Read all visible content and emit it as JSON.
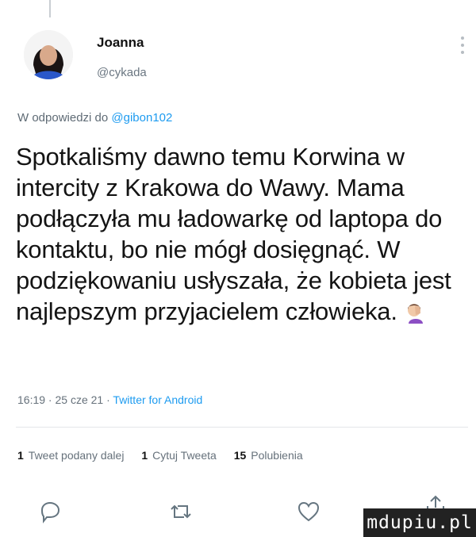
{
  "author": {
    "name": "Joanna",
    "handle": "@cykada"
  },
  "reply": {
    "prefix": "W odpowiedzi do",
    "mention": "@gibon102"
  },
  "tweet": {
    "text": "Spotkaliśmy dawno temu Korwina w intercity z Krakowa do Wawy. Mama podłączyła mu ładowarkę od laptopa do kontaktu, bo nie mógł dosięgnąć. W podziękowaniu usłyszała, że kobieta jest najlepszym przyjacielem człowieka.",
    "emoji_icon": "facepalm-icon"
  },
  "meta": {
    "time": "16:19",
    "sep1": " · ",
    "date": "25 cze 21",
    "sep2": " · ",
    "app": "Twitter for Android"
  },
  "stats": {
    "retweets_count": "1",
    "retweets_label": "Tweet podany dalej",
    "quotes_count": "1",
    "quotes_label": "Cytuj Tweeta",
    "likes_count": "15",
    "likes_label": "Polubienia"
  },
  "actions": {
    "icons": [
      "reply-icon",
      "retweet-icon",
      "like-icon",
      "share-icon"
    ]
  },
  "watermark": {
    "text": "mdupiu.pl"
  },
  "colors": {
    "link": "#1d9bf0",
    "muted": "#66717b",
    "text": "#141414"
  }
}
